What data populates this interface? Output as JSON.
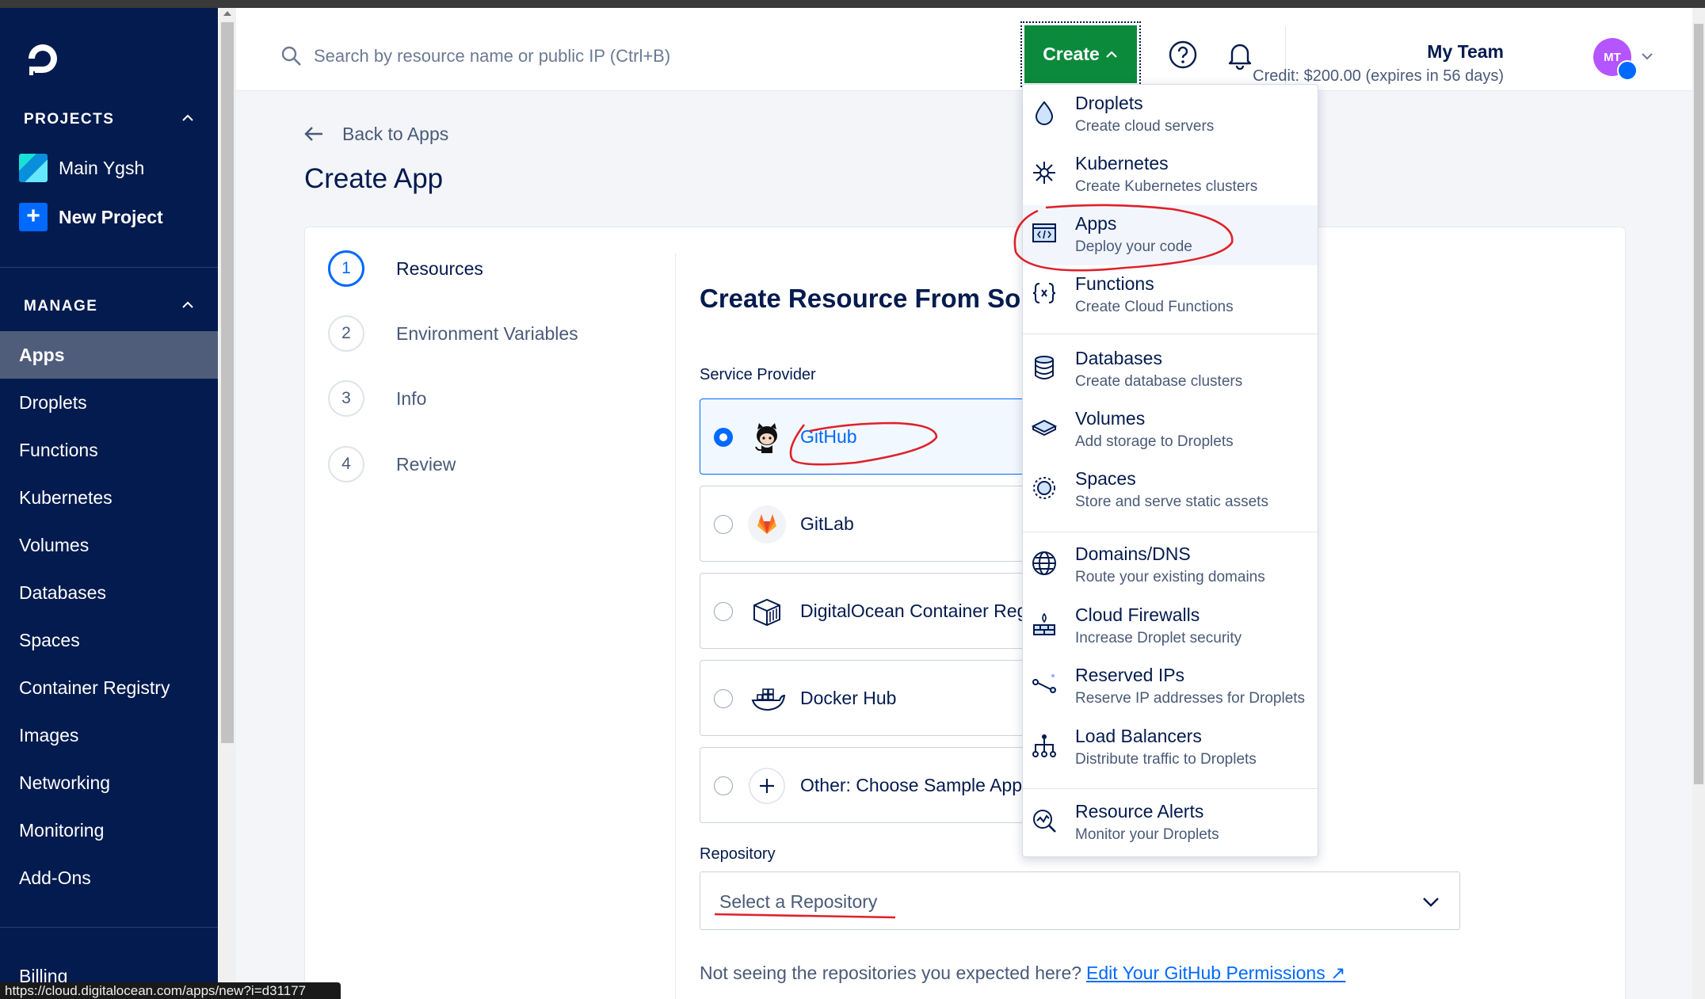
{
  "sidebar": {
    "projects_heading": "PROJECTS",
    "projects": [
      {
        "label": "Main Ygsh"
      },
      {
        "label": "New Project"
      }
    ],
    "manage_heading": "MANAGE",
    "nav": [
      {
        "label": "Apps",
        "active": true
      },
      {
        "label": "Droplets"
      },
      {
        "label": "Functions"
      },
      {
        "label": "Kubernetes"
      },
      {
        "label": "Volumes"
      },
      {
        "label": "Databases"
      },
      {
        "label": "Spaces"
      },
      {
        "label": "Container Registry"
      },
      {
        "label": "Images"
      },
      {
        "label": "Networking"
      },
      {
        "label": "Monitoring"
      },
      {
        "label": "Add-Ons"
      }
    ],
    "billing": "Billing"
  },
  "header": {
    "search_placeholder": "Search by resource name or public IP (Ctrl+B)",
    "create_label": "Create",
    "team_name": "My Team",
    "credit": "Credit: $200.00 (expires in 56 days)",
    "avatar_initials": "MT"
  },
  "page": {
    "back_label": "Back to Apps",
    "title": "Create App",
    "steps": [
      {
        "num": "1",
        "label": "Resources",
        "active": true
      },
      {
        "num": "2",
        "label": "Environment Variables"
      },
      {
        "num": "3",
        "label": "Info"
      },
      {
        "num": "4",
        "label": "Review"
      }
    ],
    "section_title": "Create Resource From Source Code",
    "service_provider_label": "Service Provider",
    "providers": [
      {
        "label": "GitHub",
        "selected": true
      },
      {
        "label": "GitLab"
      },
      {
        "label": "DigitalOcean Container Registry"
      },
      {
        "label": "Docker Hub"
      },
      {
        "label": "Other: Choose Sample App"
      }
    ],
    "repository_label": "Repository",
    "repository_placeholder": "Select a Repository",
    "permissions_note": "Not seeing the repositories you expected here?",
    "permissions_link": "Edit Your GitHub Permissions"
  },
  "create_menu": [
    {
      "title": "Droplets",
      "sub": "Create cloud servers",
      "icon": "droplet-icon"
    },
    {
      "title": "Kubernetes",
      "sub": "Create Kubernetes clusters",
      "icon": "kubernetes-icon"
    },
    {
      "title": "Apps",
      "sub": "Deploy your code",
      "icon": "apps-icon",
      "highlighted": true
    },
    {
      "title": "Functions",
      "sub": "Create Cloud Functions",
      "icon": "functions-icon"
    },
    {
      "title": "Databases",
      "sub": "Create database clusters",
      "icon": "database-icon"
    },
    {
      "title": "Volumes",
      "sub": "Add storage to Droplets",
      "icon": "volume-icon"
    },
    {
      "title": "Spaces",
      "sub": "Store and serve static assets",
      "icon": "spaces-icon"
    },
    {
      "title": "Domains/DNS",
      "sub": "Route your existing domains",
      "icon": "globe-icon"
    },
    {
      "title": "Cloud Firewalls",
      "sub": "Increase Droplet security",
      "icon": "firewall-icon"
    },
    {
      "title": "Reserved IPs",
      "sub": "Reserve IP addresses for Droplets",
      "icon": "reserved-ip-icon"
    },
    {
      "title": "Load Balancers",
      "sub": "Distribute traffic to Droplets",
      "icon": "load-balancer-icon"
    },
    {
      "title": "Resource Alerts",
      "sub": "Monitor your Droplets",
      "icon": "alert-chart-icon"
    }
  ],
  "status_url": "https://cloud.digitalocean.com/apps/new?i=d31177",
  "colors": {
    "brand_navy": "#031b4e",
    "accent_blue": "#0069ff",
    "create_green": "#0b8a3c",
    "annotation_red": "#e0202a"
  }
}
